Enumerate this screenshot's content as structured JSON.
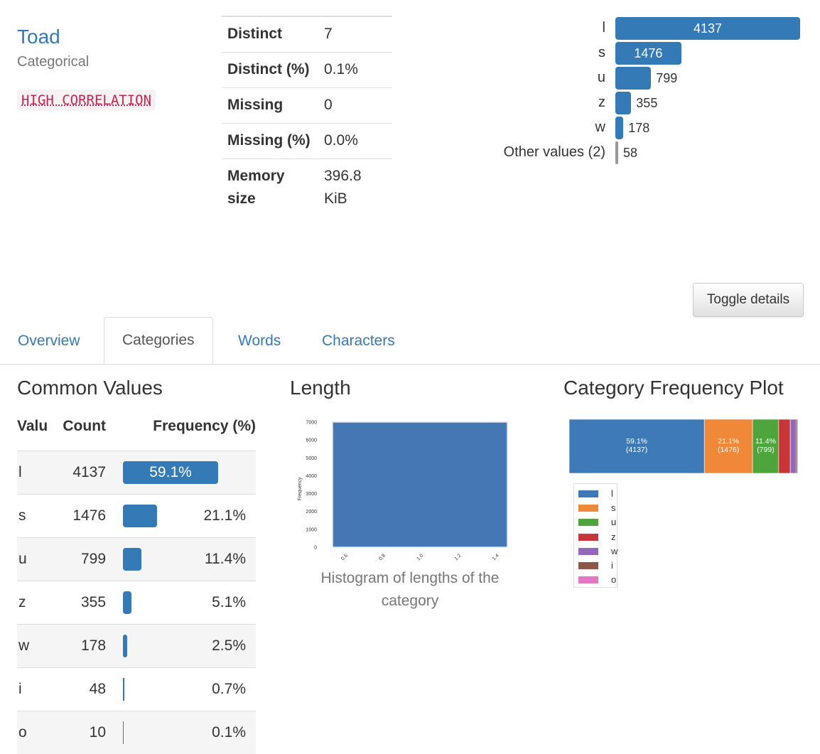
{
  "variable": {
    "name": "Toad",
    "type": "Categorical",
    "badge": "HIGH CORRELATION"
  },
  "stats": [
    {
      "key": "Distinct",
      "value": "7"
    },
    {
      "key": "Distinct (%)",
      "value": "0.1%"
    },
    {
      "key": "Missing",
      "value": "0"
    },
    {
      "key": "Missing (%)",
      "value": "0.0%"
    },
    {
      "key": "Memory size",
      "value": "396.8 KiB"
    }
  ],
  "mini_freq": [
    {
      "label": "l",
      "count": "4137",
      "value": 4137,
      "other": false
    },
    {
      "label": "s",
      "count": "1476",
      "value": 1476,
      "other": false
    },
    {
      "label": "u",
      "count": "799",
      "value": 799,
      "other": false
    },
    {
      "label": "z",
      "count": "355",
      "value": 355,
      "other": false
    },
    {
      "label": "w",
      "count": "178",
      "value": 178,
      "other": false
    },
    {
      "label": "Other values (2)",
      "count": "58",
      "value": 58,
      "other": true
    }
  ],
  "toggle_label": "Toggle details",
  "tabs": [
    {
      "label": "Overview",
      "active": false
    },
    {
      "label": "Categories",
      "active": true
    },
    {
      "label": "Words",
      "active": false
    },
    {
      "label": "Characters",
      "active": false
    }
  ],
  "sections": {
    "common_values": "Common Values",
    "length": "Length",
    "category_plot": "Category Frequency Plot"
  },
  "common_values": {
    "headers": {
      "value": "Value",
      "count": "Count",
      "frequency": "Frequency (%)"
    },
    "rows": [
      {
        "value": "l",
        "count": "4137",
        "freq": "59.1%",
        "pct": 59.1
      },
      {
        "value": "s",
        "count": "1476",
        "freq": "21.1%",
        "pct": 21.1
      },
      {
        "value": "u",
        "count": "799",
        "freq": "11.4%",
        "pct": 11.4
      },
      {
        "value": "z",
        "count": "355",
        "freq": "5.1%",
        "pct": 5.1
      },
      {
        "value": "w",
        "count": "178",
        "freq": "2.5%",
        "pct": 2.5
      },
      {
        "value": "i",
        "count": "48",
        "freq": "0.7%",
        "pct": 0.7
      },
      {
        "value": "o",
        "count": "10",
        "freq": "0.1%",
        "pct": 0.1
      }
    ]
  },
  "histogram": {
    "caption": "Histogram of lengths of the category",
    "ylabel": "Frequency"
  },
  "chart_data": [
    {
      "type": "bar",
      "title": "",
      "ylabel": "Frequency",
      "xlabel": "",
      "x_ticks": [
        "0.6",
        "0.8",
        "1.0",
        "1.2",
        "1.4"
      ],
      "y_ticks": [
        "0",
        "1000",
        "2000",
        "3000",
        "4000",
        "5000",
        "6000",
        "7000"
      ],
      "xlim": [
        0.5,
        1.5
      ],
      "ylim": [
        0,
        7000
      ],
      "bins": [
        {
          "x0": 0.5,
          "x1": 1.5,
          "value": 7003
        }
      ],
      "color": "#4477b4"
    },
    {
      "type": "bar",
      "stacked": true,
      "orientation": "horizontal",
      "categories": [
        "l",
        "s",
        "u",
        "z",
        "w",
        "i",
        "o"
      ],
      "values": [
        4137,
        1476,
        799,
        355,
        178,
        48,
        10
      ],
      "labels": [
        [
          "59.1%",
          "(4137)"
        ],
        [
          "21.1%",
          "(1476)"
        ],
        [
          "11.4%",
          "(799)"
        ],
        [
          "",
          ""
        ],
        [
          "",
          ""
        ],
        [
          "",
          ""
        ],
        [
          "",
          ""
        ]
      ],
      "colors": [
        "#3f7ab8",
        "#f0883a",
        "#4ea53c",
        "#c9363a",
        "#9467bd",
        "#8c564b",
        "#e377c2"
      ],
      "legend": "bottom-left"
    }
  ]
}
